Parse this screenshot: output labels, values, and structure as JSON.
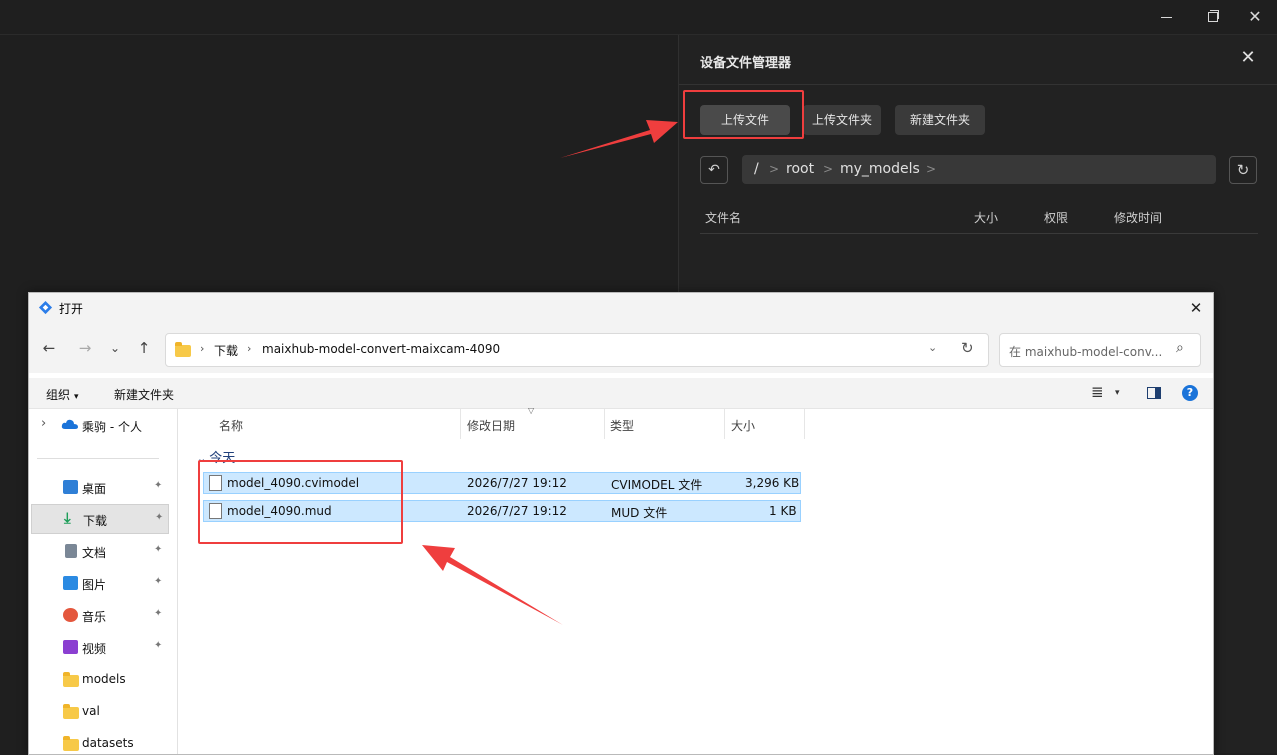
{
  "window": {
    "controls": {
      "close_glyph": "✕"
    }
  },
  "panel": {
    "title": "设备文件管理器",
    "close_glyph": "✕",
    "buttons": {
      "upload_file": "上传文件",
      "upload_folder": "上传文件夹",
      "new_folder": "新建文件夹"
    },
    "back_glyph": "↶",
    "refresh_glyph": "↻",
    "path": {
      "root_slash": "/",
      "segments": [
        "root",
        "my_models"
      ],
      "separator": ">"
    },
    "columns": {
      "name": "文件名",
      "size": "大小",
      "permissions": "权限",
      "modified": "修改时间"
    }
  },
  "dialog": {
    "title": "打开",
    "close_glyph": "✕",
    "nav": {
      "back": "←",
      "forward": "→",
      "recent": "⌄",
      "up": "↑"
    },
    "address": {
      "separator": "›",
      "segments": [
        "下载",
        "maixhub-model-convert-maixcam-4090"
      ],
      "dropdown": "⌄",
      "refresh": "↻"
    },
    "search": {
      "placeholder": "在 maixhub-model-conv...",
      "icon": "⌕"
    },
    "commands": {
      "organize": "组织",
      "organize_caret": "▾",
      "new_folder": "新建文件夹",
      "view_icon": "≣",
      "view_caret": "▾",
      "help": "?"
    },
    "sidebar": {
      "cloud": {
        "expander": "›",
        "label": "乘驹 - 个人"
      },
      "pin_glyph": "📌",
      "items": [
        {
          "label": "桌面",
          "pinned": true,
          "color": "#2f7fd6"
        },
        {
          "label": "下载",
          "pinned": true,
          "color": "#1e9e5a",
          "selected": true
        },
        {
          "label": "文档",
          "pinned": true,
          "color": "#7a8796"
        },
        {
          "label": "图片",
          "pinned": true,
          "color": "#2b8ae2"
        },
        {
          "label": "音乐",
          "pinned": true,
          "color": "#e4573d"
        },
        {
          "label": "视频",
          "pinned": true,
          "color": "#8b3fd1"
        },
        {
          "label": "models",
          "pinned": false,
          "color": "#f7c948"
        },
        {
          "label": "val",
          "pinned": false,
          "color": "#f7c948"
        },
        {
          "label": "datasets",
          "pinned": false,
          "color": "#f7c948"
        }
      ]
    },
    "files": {
      "columns": {
        "name": "名称",
        "modified": "修改日期",
        "type": "类型",
        "size": "大小"
      },
      "group": "今天",
      "group_glyph": "⌄",
      "rows": [
        {
          "name": "model_4090.cvimodel",
          "modified": "2026/7/27 19:12",
          "type": "CVIMODEL 文件",
          "size": "3,296 KB"
        },
        {
          "name": "model_4090.mud",
          "modified": "2026/7/27 19:12",
          "type": "MUD 文件",
          "size": "1 KB"
        }
      ]
    }
  },
  "annotations": {
    "color": "#ef3e3e"
  }
}
